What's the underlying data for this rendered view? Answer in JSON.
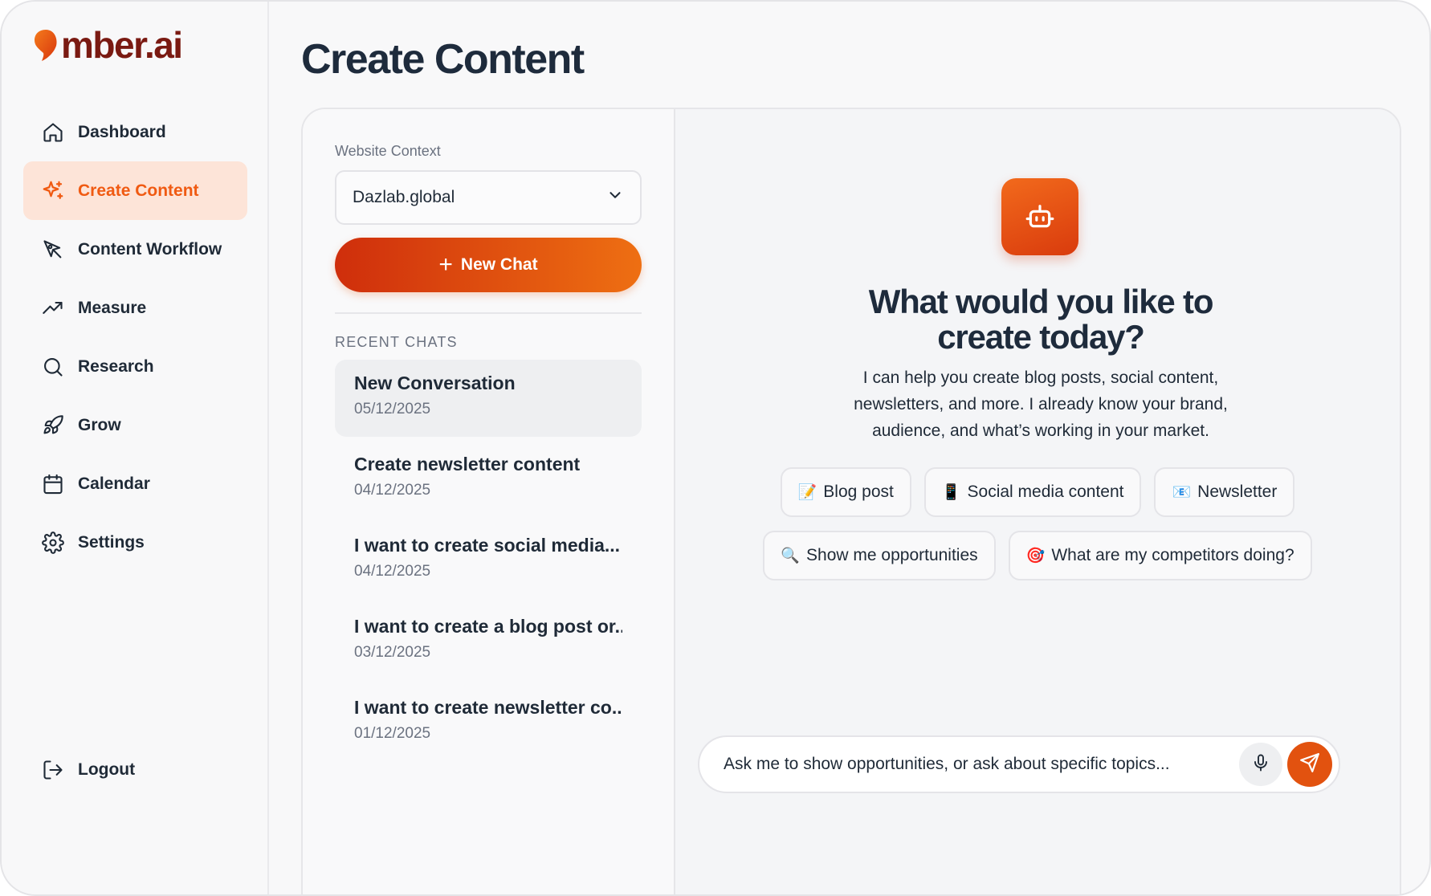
{
  "app": {
    "logo_text": "mber.ai",
    "brand_color": "#e2520f"
  },
  "sidebar": {
    "items": [
      {
        "label": "Dashboard",
        "icon": "home-icon",
        "active": false
      },
      {
        "label": "Create Content",
        "icon": "sparkles-icon",
        "active": true
      },
      {
        "label": "Content Workflow",
        "icon": "pen-tool-icon",
        "active": false
      },
      {
        "label": "Measure",
        "icon": "trending-up-icon",
        "active": false
      },
      {
        "label": "Research",
        "icon": "search-icon",
        "active": false
      },
      {
        "label": "Grow",
        "icon": "rocket-icon",
        "active": false
      },
      {
        "label": "Calendar",
        "icon": "calendar-icon",
        "active": false
      },
      {
        "label": "Settings",
        "icon": "gear-icon",
        "active": false
      }
    ],
    "logout_label": "Logout"
  },
  "header": {
    "title": "Create Content"
  },
  "left_panel": {
    "context_label": "Website Context",
    "context_value": "Dazlab.global",
    "new_chat_label": "New Chat",
    "recent_label": "RECENT CHATS",
    "chats": [
      {
        "title": "New Conversation",
        "date": "05/12/2025",
        "active": true
      },
      {
        "title": "Create newsletter content",
        "date": "04/12/2025",
        "active": false
      },
      {
        "title": "I want to create social media...",
        "date": "04/12/2025",
        "active": false
      },
      {
        "title": "I want to create a blog post or...",
        "date": "03/12/2025",
        "active": false
      },
      {
        "title": "I want to create newsletter co...",
        "date": "01/12/2025",
        "active": false
      }
    ]
  },
  "assistant": {
    "icon": "robot-icon",
    "title": "What would you like to create today?",
    "subtitle": "I can help you create blog posts, social content, newsletters, and more. I already know your brand, audience, and what’s working in your market.",
    "chips_row1": [
      {
        "emoji": "📝",
        "label": "Blog post"
      },
      {
        "emoji": "📱",
        "label": "Social media content"
      },
      {
        "emoji": "📧",
        "label": "Newsletter"
      }
    ],
    "chips_row2": [
      {
        "emoji": "🔍",
        "label": "Show me opportunities"
      },
      {
        "emoji": "🎯",
        "label": "What are my competitors doing?"
      }
    ],
    "input_placeholder": "Ask me to show opportunities, or ask about specific topics..."
  }
}
